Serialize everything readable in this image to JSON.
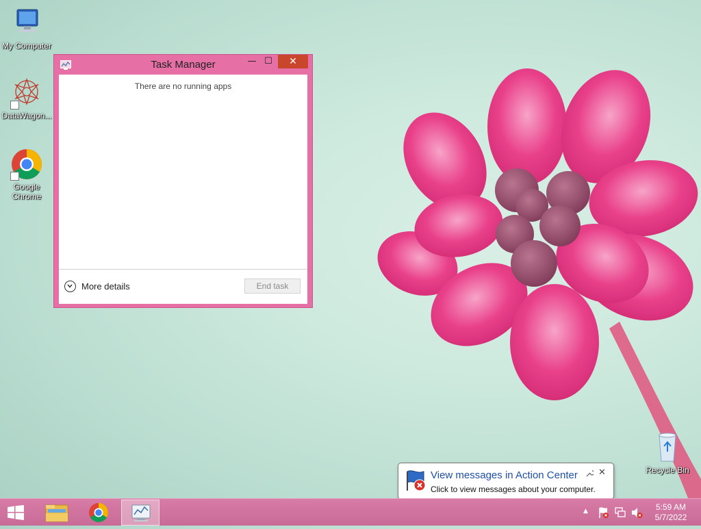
{
  "desktop": {
    "icons": [
      {
        "label": "My Computer"
      },
      {
        "label": "DataWagon..."
      },
      {
        "label": "Google Chrome"
      },
      {
        "label": "Recycle Bin"
      }
    ]
  },
  "task_manager": {
    "title": "Task Manager",
    "controls": {
      "minimize": "—",
      "maximize": "☐",
      "close": "✕"
    },
    "empty_message": "There are no running apps",
    "more_details_label": "More details",
    "end_task_label": "End task"
  },
  "notification": {
    "title": "View messages in Action Center",
    "text": "Click to view messages about your computer.",
    "close": "✕"
  },
  "taskbar": {
    "clock_time": "5:59 AM",
    "clock_date": "5/7/2022",
    "tray_expand": "▲"
  },
  "colors": {
    "window_frame": "#e66fa5",
    "taskbar": "#cf72a0",
    "close_button": "#c9462c",
    "link_blue": "#1e4fa8"
  }
}
